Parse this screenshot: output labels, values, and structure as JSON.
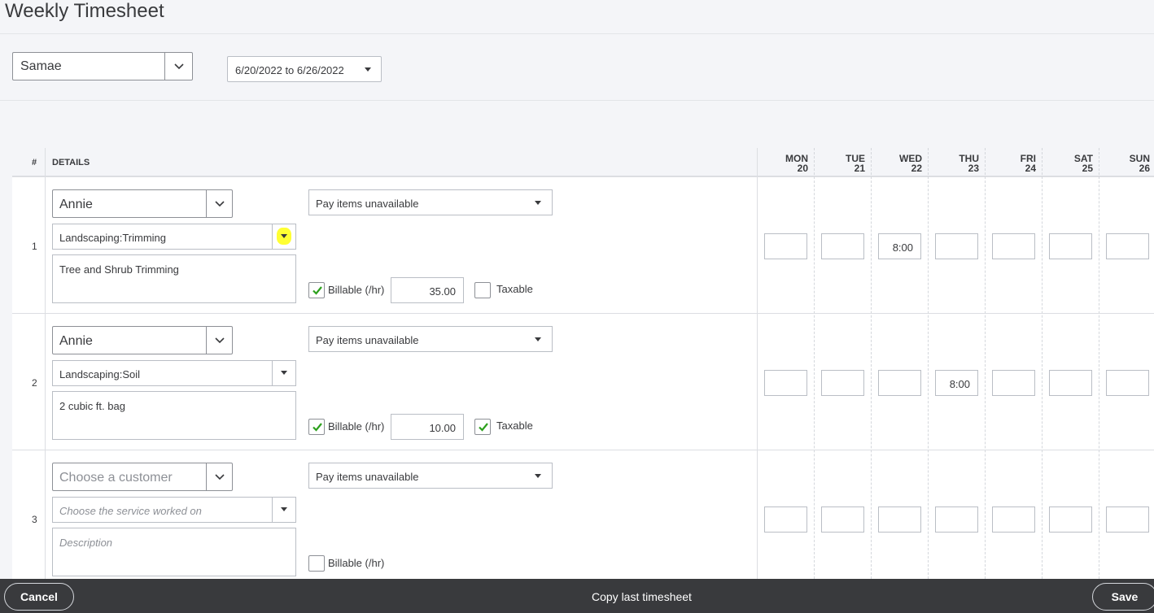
{
  "page": {
    "title": "Weekly Timesheet"
  },
  "filters": {
    "employee": "Samae",
    "date_range": "6/20/2022 to 6/26/2022"
  },
  "grid": {
    "hash_label": "#",
    "details_label": "DETAILS",
    "days": [
      {
        "name": "MON",
        "date": "20"
      },
      {
        "name": "TUE",
        "date": "21"
      },
      {
        "name": "WED",
        "date": "22"
      },
      {
        "name": "THU",
        "date": "23"
      },
      {
        "name": "FRI",
        "date": "24"
      },
      {
        "name": "SAT",
        "date": "25"
      },
      {
        "name": "SUN",
        "date": "26"
      }
    ],
    "rows": [
      {
        "num": "1",
        "customer": "Annie",
        "service": "Landscaping:Trimming",
        "description": "Tree and Shrub Trimming",
        "pay_item": "Pay items unavailable",
        "billable_label": "Billable (/hr)",
        "billable_checked": true,
        "rate": "35.00",
        "taxable_label": "Taxable",
        "taxable_checked": false,
        "hours": [
          "",
          "",
          "8:00",
          "",
          "",
          "",
          ""
        ]
      },
      {
        "num": "2",
        "customer": "Annie",
        "service": "Landscaping:Soil",
        "description": "2 cubic ft. bag",
        "pay_item": "Pay items unavailable",
        "billable_label": "Billable (/hr)",
        "billable_checked": true,
        "rate": "10.00",
        "taxable_label": "Taxable",
        "taxable_checked": true,
        "hours": [
          "",
          "",
          "",
          "8:00",
          "",
          "",
          ""
        ]
      },
      {
        "num": "3",
        "customer_placeholder": "Choose a customer",
        "service_placeholder": "Choose the service worked on",
        "description_placeholder": "Description",
        "pay_item": "Pay items unavailable",
        "billable_label": "Billable (/hr)",
        "billable_checked": false,
        "hours": [
          "",
          "",
          "",
          "",
          "",
          "",
          ""
        ]
      }
    ]
  },
  "footer": {
    "cancel": "Cancel",
    "copy": "Copy last timesheet",
    "save": "Save"
  },
  "colors": {
    "checkmark": "#2ca01c",
    "highlight": "#ffff33",
    "footer_bg": "#393a3d"
  }
}
